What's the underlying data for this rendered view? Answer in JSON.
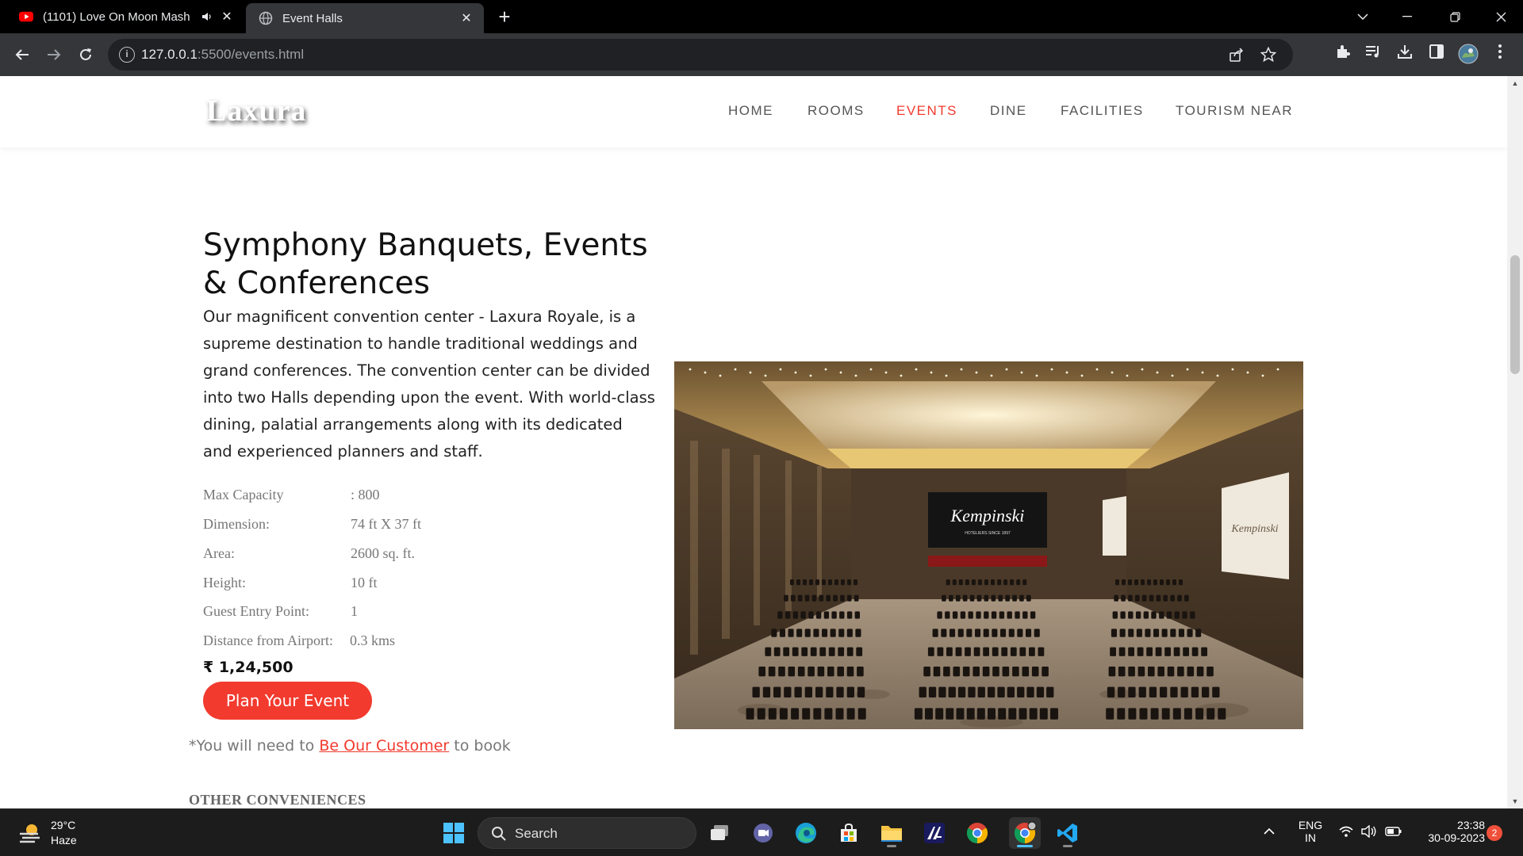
{
  "browser": {
    "tabs": [
      {
        "title": "(1101) Love On Moon Mash",
        "icon": "youtube-icon",
        "audio": true,
        "active": false
      },
      {
        "title": "Event Halls",
        "icon": "globe-icon",
        "active": true
      }
    ],
    "url_host": "127.0.0.1",
    "url_rest": ":5500/events.html"
  },
  "site": {
    "logo": "Laxura",
    "nav": [
      {
        "label": "HOME",
        "active": false
      },
      {
        "label": "ROOMS",
        "active": false
      },
      {
        "label": "EVENTS",
        "active": true
      },
      {
        "label": "DINE",
        "active": false
      },
      {
        "label": "FACILITIES",
        "active": false
      },
      {
        "label": "TOURISM NEAR",
        "active": false
      }
    ],
    "accent_color": "#f23a2e"
  },
  "hall": {
    "title": "Symphony Banquets, Events & Conferences",
    "description": "Our magnificent convention center - Laxura Royale, is a supreme destination to handle traditional weddings and grand conferences. The convention center can be divided into two Halls depending upon the event. With world-class dining, palatial arrangements along with its dedicated and experienced planners and staff.",
    "specs": [
      {
        "label": "Max Capacity",
        "value": ": 800"
      },
      {
        "label": "Dimension:",
        "value": "74 ft X 37 ft"
      },
      {
        "label": "Area:",
        "value": "2600 sq. ft."
      },
      {
        "label": "Height:",
        "value": "10 ft"
      },
      {
        "label": "Guest Entry Point:",
        "value": "1"
      },
      {
        "label": "Distance from Airport:",
        "value": "0.3 kms"
      }
    ],
    "price": "₹ 1,24,500",
    "cta_label": "Plan Your Event",
    "note_prefix": "*You will need to ",
    "note_link": "Be Our Customer",
    "note_suffix": " to book",
    "image_screen_brand": "Kempinski",
    "image_screen_sub": "HOTELIERS SINCE 1897",
    "other_heading": "OTHER CONVENIENCES"
  },
  "taskbar": {
    "weather_temp": "29°C",
    "weather_desc": "Haze",
    "search_label": "Search",
    "lang_top": "ENG",
    "lang_bottom": "IN",
    "time": "23:38",
    "date": "30-09-2023",
    "notifications": "2"
  }
}
